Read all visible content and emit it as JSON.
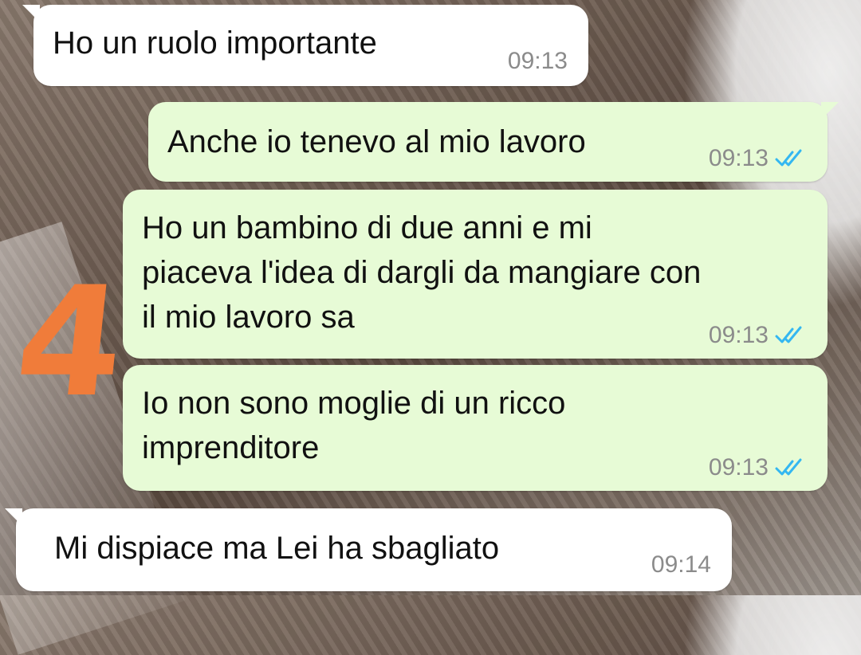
{
  "colors": {
    "incoming_bubble": "#ffffff",
    "outgoing_bubble": "#e7fbd6",
    "timestamp": "#8b8b8b",
    "read_ticks": "#34b7f1",
    "annotation": "#f07c3a"
  },
  "annotation": {
    "label": "4"
  },
  "messages": [
    {
      "direction": "incoming",
      "text": "Ho un ruolo importante",
      "time": "09:13",
      "status": ""
    },
    {
      "direction": "outgoing",
      "text": "Anche io tenevo al mio lavoro",
      "time": "09:13",
      "status": "read-double-check-icon"
    },
    {
      "direction": "outgoing",
      "text": "Ho un bambino di due anni e mi\npiaceva l'idea di dargli da mangiare con\nil mio lavoro sa",
      "time": "09:13",
      "status": "read-double-check-icon"
    },
    {
      "direction": "outgoing",
      "text": "Io non sono moglie di un ricco\nimprenditore",
      "time": "09:13",
      "status": "read-double-check-icon"
    },
    {
      "direction": "incoming",
      "text": "Mi dispiace ma Lei ha sbagliato",
      "time": "09:14",
      "status": ""
    }
  ]
}
